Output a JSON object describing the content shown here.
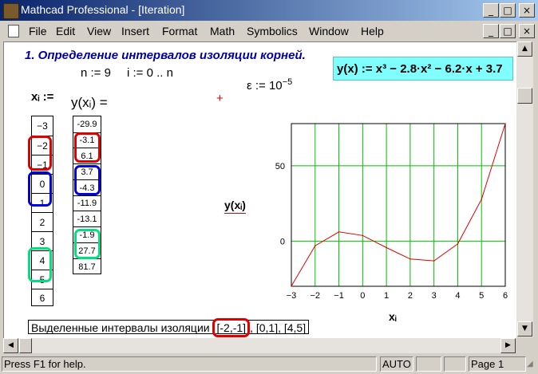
{
  "window": {
    "title": "Mathcad Professional - [Iteration]",
    "btn_min": "_",
    "btn_max": "□",
    "btn_close": "×"
  },
  "menu": [
    "File",
    "Edit",
    "View",
    "Insert",
    "Format",
    "Math",
    "Symbolics",
    "Window",
    "Help"
  ],
  "doc": {
    "heading": "1. Определение интервалов изоляции корней.",
    "n_def": "n := 9",
    "i_def": "i := 0 .. n",
    "eps_def": "ε := 10",
    "eps_exp": "−5",
    "func_def": "y(x) := x³ − 2.8·x² − 6.2·x + 3.7",
    "xi_label": "xᵢ :=",
    "yxi_label": "y(xᵢ) =",
    "xi_values": [
      "−3",
      "−2",
      "−1",
      "0",
      "1",
      "2",
      "3",
      "4",
      "5",
      "6"
    ],
    "y_values": [
      "-29.9",
      "-3.1",
      "6.1",
      "3.7",
      "-4.3",
      "-11.9",
      "-13.1",
      "-1.9",
      "27.7",
      "81.7"
    ],
    "plot_ylabel": "y(xᵢ)",
    "plot_xlabel": "xᵢ",
    "cross_mark": "+",
    "intervals_label": "Выделенные интервалы изоляции",
    "interval_1": "[-2,-1]",
    "interval_rest": ", [0,1], [4,5]"
  },
  "chart_data": {
    "type": "line",
    "x": [
      -3,
      -2,
      -1,
      0,
      1,
      2,
      3,
      4,
      5,
      6
    ],
    "series": [
      {
        "values": [
          -29.9,
          -3.1,
          6.1,
          3.7,
          -4.3,
          -11.9,
          -13.1,
          -1.9,
          27.7,
          81.7
        ],
        "color": "#e00000"
      }
    ],
    "xlim": [
      -3,
      6
    ],
    "ylim": [
      -30,
      78
    ],
    "xticks": [
      "−3",
      "−2",
      "−1",
      "0",
      "1",
      "2",
      "3",
      "4",
      "5",
      "6"
    ],
    "yticks": [
      "0",
      "50"
    ],
    "grid": true,
    "grid_color": "#00c000"
  },
  "status": {
    "help": "Press F1 for help.",
    "mode": "AUTO",
    "page": "Page 1"
  },
  "colors": {
    "title_bar": "#0a246a",
    "heading": "#0000a0",
    "highlight_box": "#80ffff",
    "ring_red": "#e00000",
    "ring_blue": "#0000e0",
    "ring_green": "#00e080"
  }
}
